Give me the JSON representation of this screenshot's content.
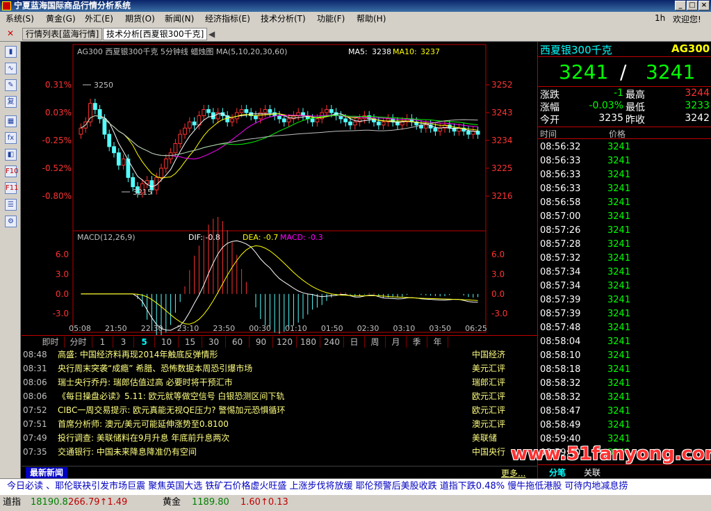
{
  "window": {
    "title": "宁夏蓝海国际商品行情分析系统"
  },
  "menu": {
    "items": [
      "系统(S)",
      "黄金(G)",
      "外汇(E)",
      "期货(O)",
      "新闻(N)",
      "经济指标(E)",
      "技术分析(T)",
      "功能(F)",
      "帮助(H)"
    ],
    "right_items": [
      "1h",
      "欢迎您!"
    ]
  },
  "tabs": [
    "行情列表[蓝海行情]",
    "技术分析[西夏银300千克]"
  ],
  "chart": {
    "header": "AG300 西夏银300千克 5分钟线 蜡烛图 MA(5,10,20,30,60)",
    "ma5_label": "MA5:",
    "ma5_value": "3238",
    "ma10_label": "MA10:",
    "ma10_value": "3237",
    "left_ticks": [
      "0.31%",
      "0.03%",
      "-0.25%",
      "-0.52%",
      "-0.80%"
    ],
    "right_ticks": [
      "3252",
      "3243",
      "3234",
      "3225",
      "3216"
    ],
    "high_label": "3250",
    "low_label": "3215",
    "macd_header": "MACD(12,26,9)",
    "dif": "DIF: -0.8",
    "dea": "DEA: -0.7",
    "macd": "MACD: -0.3",
    "macd_left_ticks": [
      "6.0",
      "3.0",
      "0.0",
      "-3.0"
    ],
    "macd_right_ticks": [
      "6.0",
      "3.0",
      "0.0",
      "-3.0"
    ],
    "time_ticks": [
      "05:08",
      "21:50",
      "22:30",
      "23:10",
      "23:50",
      "00:30",
      "01:10",
      "01:50",
      "02:30",
      "03:10",
      "03:50",
      "06:25"
    ]
  },
  "periods": [
    "即时",
    "分时",
    "1",
    "3",
    "5",
    "10",
    "15",
    "30",
    "60",
    "90",
    "120",
    "180",
    "240",
    "日",
    "周",
    "月",
    "季",
    "年"
  ],
  "active_period": "5",
  "news": [
    {
      "time": "08:48",
      "title": "高盛: 中国经济料再现2014年触底反弹情形",
      "source": "中国经济"
    },
    {
      "time": "08:31",
      "title": "央行周末突袭“成瘾” 希腊、恐怖数据本周恐引爆市场",
      "source": "美元汇评"
    },
    {
      "time": "08:06",
      "title": "瑞士央行乔丹: 瑞郎估值过高 必要时将干预汇市",
      "source": "瑞郎汇评"
    },
    {
      "time": "08:06",
      "title": "《每日操盘必读》5.11: 欧元就等做空信号 白银恐测区间下轨",
      "source": "欧元汇评"
    },
    {
      "time": "07:52",
      "title": "CIBC一周交易提示: 欧元真能无视QE压力? 警惕加元恐惧循环",
      "source": "欧元汇评"
    },
    {
      "time": "07:51",
      "title": "首席分析师: 澳元/美元可能延伸涨势至0.8100",
      "source": "澳元汇评"
    },
    {
      "time": "07:49",
      "title": "投行调查: 美联储料在9月升息 年底前升息两次",
      "source": "美联储"
    },
    {
      "time": "07:35",
      "title": "交通银行: 中国未来降息降准仍有空间",
      "source": "中国央行"
    }
  ],
  "news_footer": {
    "title": "最新新闻",
    "more": "更多..."
  },
  "quote": {
    "name": "西夏银300千克",
    "code": "AG300",
    "bid": "3241",
    "sep": "/",
    "ask": "3241",
    "rows": [
      {
        "l1": "涨跌",
        "v1": "-1",
        "l2": "最高",
        "v2": "3244"
      },
      {
        "l1": "涨幅",
        "v1": "-0.03%",
        "l2": "最低",
        "v2": "3233"
      },
      {
        "l1": "今开",
        "v1": "3235",
        "l2": "昨收",
        "v2": "3242"
      }
    ],
    "col_time": "时间",
    "col_price": "价格",
    "ticks": [
      {
        "t": "08:56:32",
        "p": "3241"
      },
      {
        "t": "08:56:33",
        "p": "3241"
      },
      {
        "t": "08:56:33",
        "p": "3241"
      },
      {
        "t": "08:56:33",
        "p": "3241"
      },
      {
        "t": "08:56:58",
        "p": "3241"
      },
      {
        "t": "08:57:00",
        "p": "3241"
      },
      {
        "t": "08:57:26",
        "p": "3241"
      },
      {
        "t": "08:57:28",
        "p": "3241"
      },
      {
        "t": "08:57:32",
        "p": "3241"
      },
      {
        "t": "08:57:34",
        "p": "3241"
      },
      {
        "t": "08:57:34",
        "p": "3241"
      },
      {
        "t": "08:57:39",
        "p": "3241"
      },
      {
        "t": "08:57:39",
        "p": "3241"
      },
      {
        "t": "08:57:48",
        "p": "3241"
      },
      {
        "t": "08:58:04",
        "p": "3241"
      },
      {
        "t": "08:58:10",
        "p": "3241"
      },
      {
        "t": "08:58:18",
        "p": "3241"
      },
      {
        "t": "08:58:32",
        "p": "3241"
      },
      {
        "t": "08:58:32",
        "p": "3241"
      },
      {
        "t": "08:58:47",
        "p": "3241"
      },
      {
        "t": "08:58:49",
        "p": "3241"
      },
      {
        "t": "08:59:40",
        "p": "3241"
      },
      {
        "t": "08:59:40",
        "p": "3241"
      }
    ],
    "bottom_tabs": [
      "分笔",
      "关联"
    ]
  },
  "ticker": "今日必读  、耶伦联袂引发市场巨震  聚焦英国大选   铁矿石价格虚火旺盛  上涨步伐将放缓   耶伦预警后美股收跌  道指下跌0.48%   慢牛拖低港股  可待内地减息捞",
  "status": {
    "dow_label": "道指",
    "dow_value": "18190.8",
    "dow_change": "266.79↑1.49",
    "gold_label": "黄金",
    "gold_value": "1189.80",
    "gold_change": "1.60↑0.13"
  },
  "watermark": "www.51fanyong.com",
  "colors": {
    "up": "#ff3232",
    "down": "#54ffff",
    "grid": "#c00000",
    "ma5": "#ffffff",
    "ma10": "#ffff00",
    "ma20": "#ff00ff",
    "ma30": "#00ff00",
    "ma60": "#c0c0c0"
  }
}
